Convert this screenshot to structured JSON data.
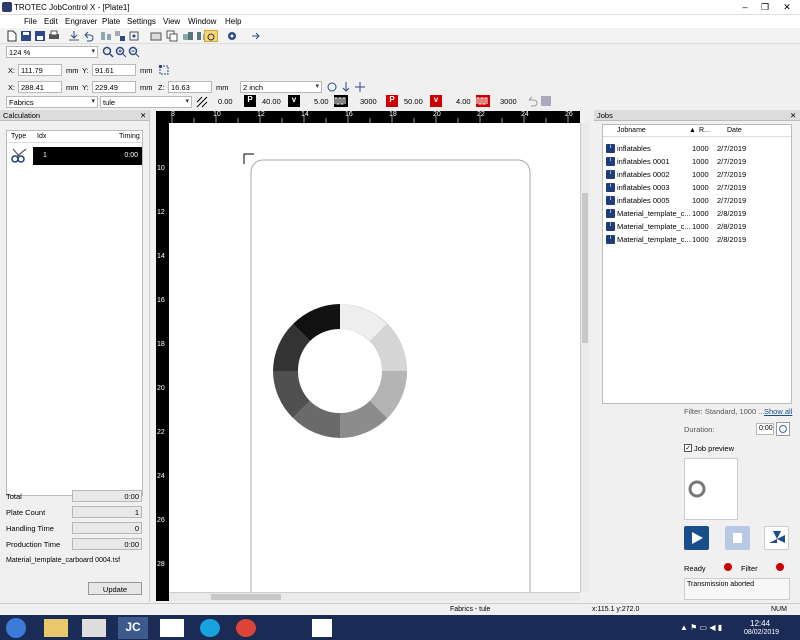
{
  "window": {
    "title": "TROTEC JobControl X - [Plate1]",
    "min": "–",
    "restore": "❐",
    "close": "✕"
  },
  "menu": [
    "File",
    "Edit",
    "Engraver",
    "Plate",
    "Settings",
    "View",
    "Window",
    "Help"
  ],
  "zoom": {
    "value": "124 %"
  },
  "position": {
    "x_label": "X:",
    "x": "111.79",
    "x_unit": "mm",
    "y_label": "Y:",
    "y": "91.61",
    "y_unit": "mm"
  },
  "size": {
    "x_label": "X:",
    "x": "288.41",
    "x_unit": "mm",
    "y_label": "Y:",
    "y": "229.49",
    "y_unit": "mm",
    "z_label": "Z:",
    "z": "16.63",
    "z_unit": "mm",
    "lens": "2 inch"
  },
  "material": {
    "group": "Fabrics",
    "name": "tule",
    "v1": "0.00",
    "p1": "40.00",
    "speed1": "5.00",
    "freq1": "3000",
    "p2": "50.00",
    "speed2": "4.00",
    "freq2": "3000",
    "p_label": "P",
    "v_label": "v"
  },
  "calculation": {
    "title": "Calculation",
    "cols": {
      "type": "Type",
      "idx": "Idx",
      "timing": "Timing"
    },
    "row": {
      "idx": "1",
      "timing": "0:00"
    },
    "total_label": "Total",
    "total": "0:00",
    "plate_count_label": "Plate Count",
    "plate_count": "1",
    "handling_label": "Handling Time",
    "handling": "0",
    "production_label": "Production Time",
    "production": "0:00",
    "file": "Material_template_carboard 0004.tsf",
    "update": "Update"
  },
  "rulers": {
    "h": [
      "8",
      "10",
      "12",
      "14",
      "16",
      "18",
      "20",
      "22",
      "24",
      "26"
    ],
    "v": [
      "10",
      "12",
      "14",
      "16",
      "18",
      "20",
      "22",
      "24",
      "26",
      "28"
    ]
  },
  "jobs": {
    "title": "Jobs",
    "cols": {
      "name": "Jobname",
      "r": "R...",
      "date": "Date"
    },
    "rows": [
      {
        "name": "inflatables",
        "r": "1000",
        "date": "2/7/2019"
      },
      {
        "name": "inflatables 0001",
        "r": "1000",
        "date": "2/7/2019"
      },
      {
        "name": "inflatables 0002",
        "r": "1000",
        "date": "2/7/2019"
      },
      {
        "name": "inflatables 0003",
        "r": "1000",
        "date": "2/7/2019"
      },
      {
        "name": "inflatables 0005",
        "r": "1000",
        "date": "2/7/2019"
      },
      {
        "name": "Material_template_c...",
        "r": "1000",
        "date": "2/8/2019"
      },
      {
        "name": "Material_template_c...",
        "r": "1000",
        "date": "2/8/2019"
      },
      {
        "name": "Material_template_c...",
        "r": "1000",
        "date": "2/8/2019"
      }
    ],
    "filter": "Filter: Standard, 1000 ...",
    "show_all": "Show all",
    "duration_label": "Duration:",
    "duration": "0:00",
    "job_preview": "Job preview",
    "ready": "Ready",
    "filter_label": "Filter",
    "message": "Transmission aborted"
  },
  "status": {
    "material": "Fabrics - tule",
    "coords": "x:115.1   y:272.0",
    "num": "NUM"
  },
  "taskbar": {
    "time": "12:44",
    "date": "08/02/2019"
  },
  "colors": {
    "ruler": "#000000",
    "title_blue": "#0078d7",
    "play_blue": "#1a4d8c",
    "taskbar": "#1a2b55",
    "status_red": "#cc0000"
  }
}
